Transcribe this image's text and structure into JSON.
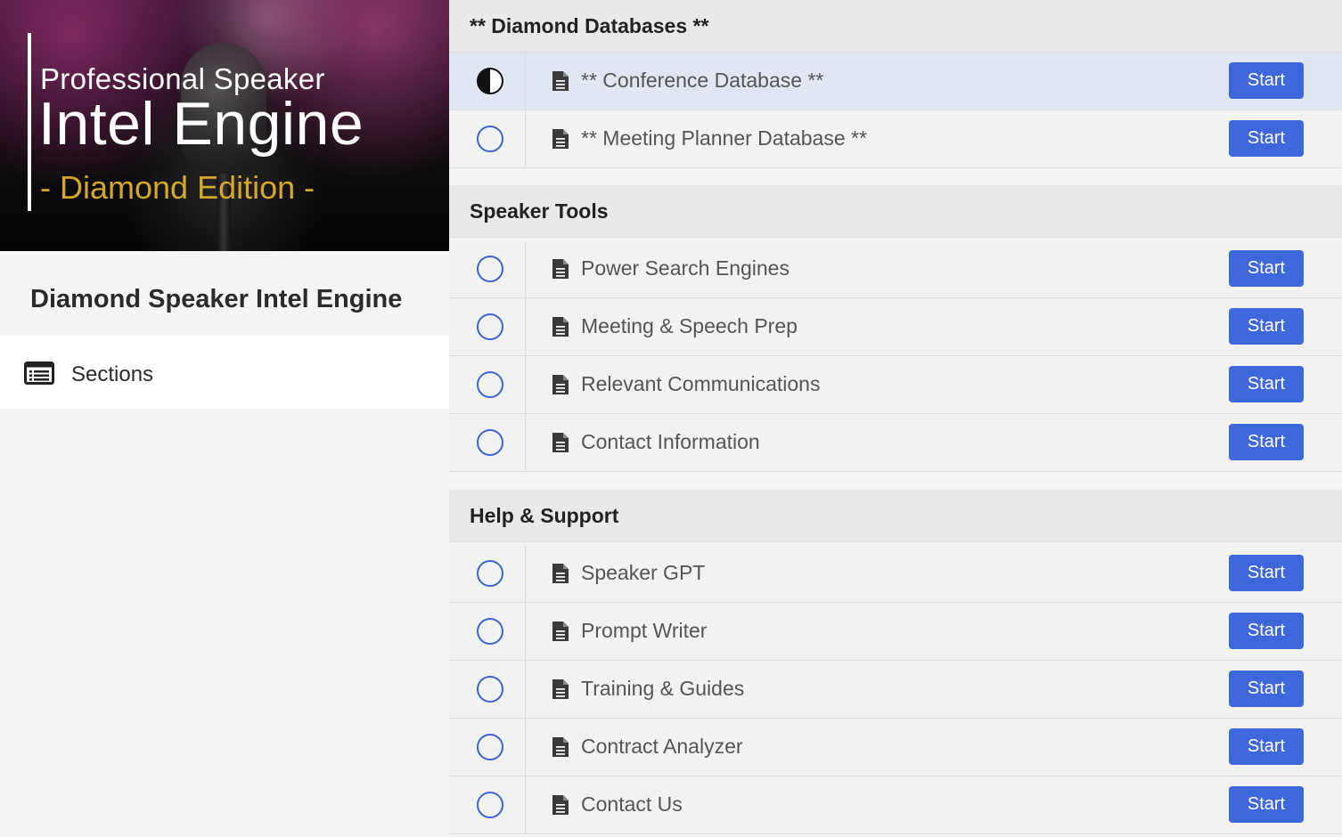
{
  "banner": {
    "line1": "Professional Speaker",
    "line2": "Intel Engine",
    "line3": "- Diamond Edition -"
  },
  "course_title": "Diamond Speaker Intel Engine",
  "nav": {
    "sections_label": "Sections",
    "icon": "list-icon"
  },
  "colors": {
    "accent": "#3f67dc",
    "edition_gold": "#d4a82a",
    "active_row": "#e0e6f2"
  },
  "sections": [
    {
      "title": "** Diamond Databases **",
      "lessons": [
        {
          "title": "** Conference Database **",
          "button": "Start",
          "status": "in-progress"
        },
        {
          "title": "** Meeting Planner Database **",
          "button": "Start",
          "status": "not-started"
        }
      ]
    },
    {
      "title": "Speaker Tools",
      "lessons": [
        {
          "title": "Power Search Engines",
          "button": "Start",
          "status": "not-started"
        },
        {
          "title": "Meeting & Speech Prep",
          "button": "Start",
          "status": "not-started"
        },
        {
          "title": "Relevant Communications",
          "button": "Start",
          "status": "not-started"
        },
        {
          "title": "Contact Information",
          "button": "Start",
          "status": "not-started"
        }
      ]
    },
    {
      "title": "Help & Support",
      "lessons": [
        {
          "title": "Speaker GPT",
          "button": "Start",
          "status": "not-started"
        },
        {
          "title": "Prompt Writer",
          "button": "Start",
          "status": "not-started"
        },
        {
          "title": "Training & Guides",
          "button": "Start",
          "status": "not-started"
        },
        {
          "title": "Contract Analyzer",
          "button": "Start",
          "status": "not-started"
        },
        {
          "title": "Contact Us",
          "button": "Start",
          "status": "not-started"
        }
      ]
    }
  ]
}
